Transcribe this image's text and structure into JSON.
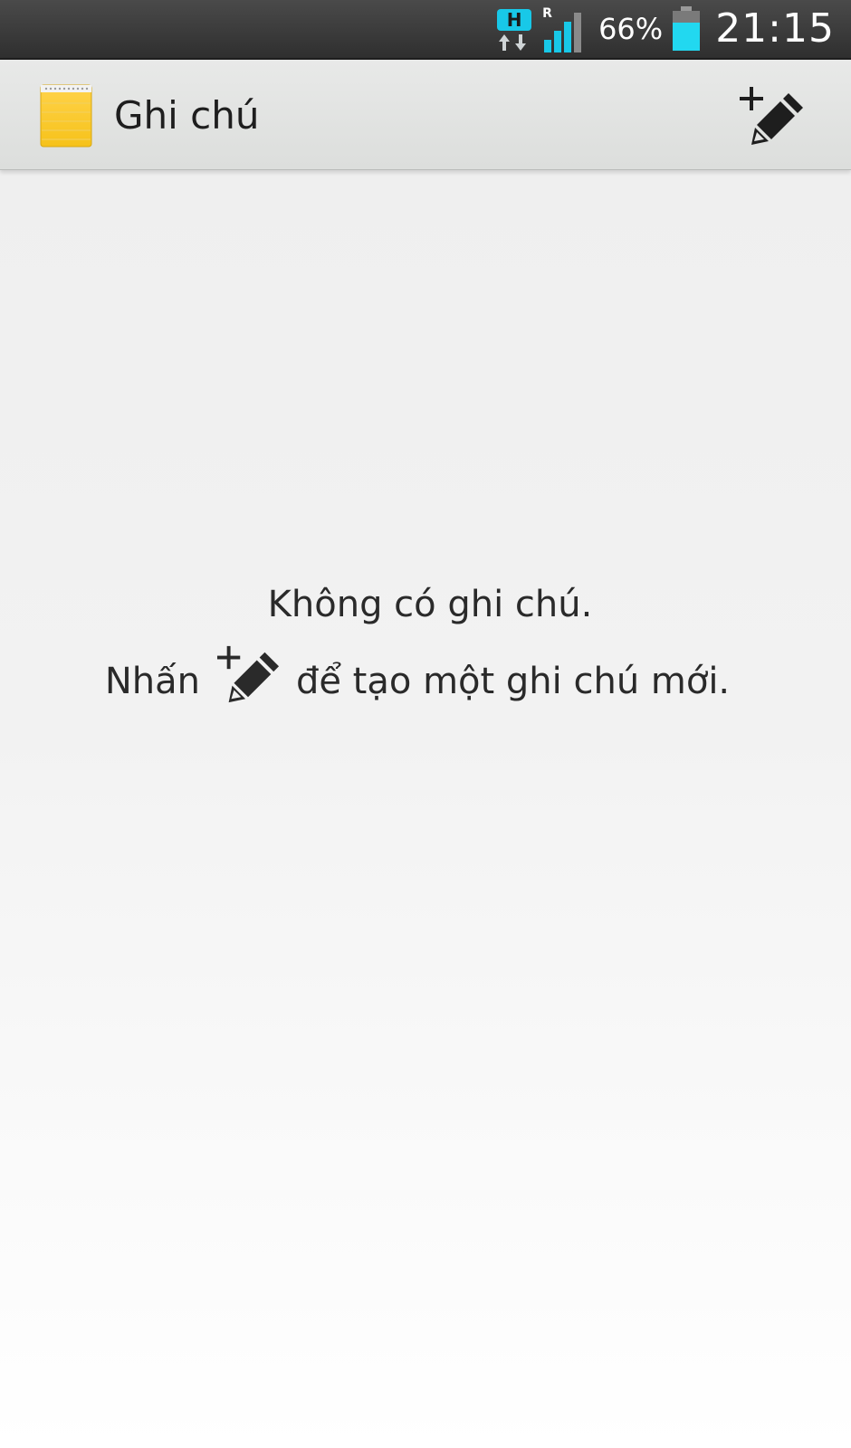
{
  "status_bar": {
    "network_type": "H",
    "roaming": "R",
    "battery_percent": "66%",
    "time": "21:15",
    "signal_icon": "signal-icon",
    "battery_icon": "battery-icon",
    "colors": {
      "accent": "#18c8e8",
      "background": "#3a3a3a"
    }
  },
  "action_bar": {
    "app_icon": "notepad-icon",
    "title": "Ghi chú",
    "new_note_icon": "new-note-icon"
  },
  "empty_state": {
    "message": "Không có ghi chú.",
    "hint_prefix": "Nhấn",
    "hint_icon": "new-note-icon",
    "hint_suffix": "để tạo một ghi chú mới."
  }
}
